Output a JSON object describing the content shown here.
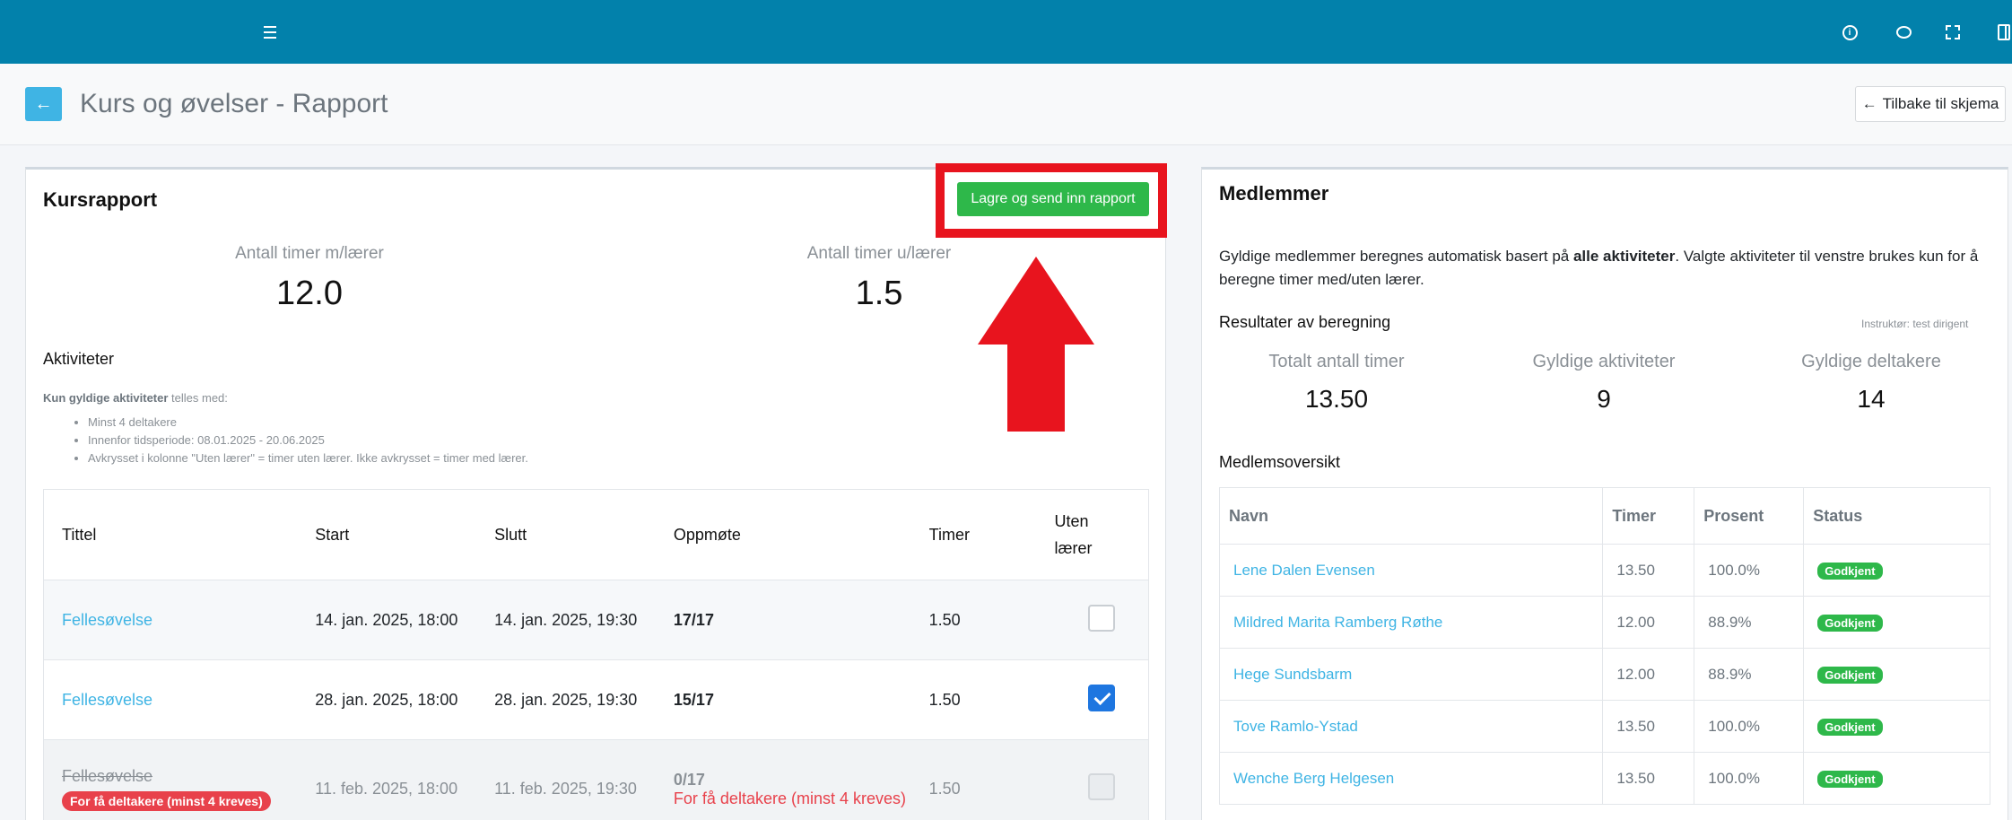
{
  "icons": {
    "menu": "hamburger-icon",
    "info": "info-icon",
    "chat": "chat-icon",
    "fullscreen": "expand-icon",
    "panel": "sidebar-icon",
    "back": "arrow-left-icon"
  },
  "colors": {
    "topbar": "#0281ab",
    "accent": "#3fb4e4",
    "success": "#2eb84a",
    "danger": "#e8414b",
    "annotation": "#e8141e"
  },
  "header": {
    "title": "Kurs og øvelser - Rapport",
    "back_to_form": "Tilbake til skjema"
  },
  "report": {
    "title": "Kursrapport",
    "submit_label": "Lagre og send inn rapport",
    "stat_with_teacher_label": "Antall timer m/lærer",
    "stat_with_teacher_value": "12.0",
    "stat_without_teacher_label": "Antall timer u/lærer",
    "stat_without_teacher_value": "1.5",
    "activities_heading": "Aktiviteter",
    "notes_bold": "Kun gyldige aktiviteter",
    "notes_rest": " telles med:",
    "rules": [
      "Minst 4 deltakere",
      "Innenfor tidsperiode: 08.01.2025 - 20.06.2025",
      "Avkrysset i kolonne \"Uten lærer\" = timer uten lærer. Ikke avkrysset = timer med lærer."
    ],
    "columns": {
      "title": "Tittel",
      "start": "Start",
      "end": "Slutt",
      "attendance": "Oppmøte",
      "hours": "Timer",
      "without_teacher_1": "Uten",
      "without_teacher_2": "lærer"
    },
    "rows": [
      {
        "title": "Fellesøvelse",
        "start": "14. jan. 2025, 18:00",
        "end": "14. jan. 2025, 19:30",
        "attendance": "17/17",
        "hours": "1.50",
        "without_teacher": false
      },
      {
        "title": "Fellesøvelse",
        "start": "28. jan. 2025, 18:00",
        "end": "28. jan. 2025, 19:30",
        "attendance": "15/17",
        "hours": "1.50",
        "without_teacher": true
      },
      {
        "title": "Fellesøvelse",
        "badge": "For få deltakere (minst 4 kreves)",
        "start": "11. feb. 2025, 18:00",
        "end": "11. feb. 2025, 19:30",
        "attendance": "0/17",
        "warning": "For få deltakere (minst 4 kreves)",
        "hours": "1.50",
        "without_teacher": false
      }
    ]
  },
  "members": {
    "title": "Medlemmer",
    "desc_part1": "Gyldige medlemmer beregnes automatisk basert på ",
    "desc_bold": "alle aktiviteter",
    "desc_part2": ". Valgte aktiviteter til venstre brukes kun for å beregne timer med/uten lærer.",
    "results_heading": "Resultater av beregning",
    "instructor": "Instruktør: test dirigent",
    "stats": [
      {
        "label": "Totalt antall timer",
        "value": "13.50"
      },
      {
        "label": "Gyldige aktiviteter",
        "value": "9"
      },
      {
        "label": "Gyldige deltakere",
        "value": "14"
      }
    ],
    "overview_heading": "Medlemsoversikt",
    "columns": {
      "name": "Navn",
      "hours": "Timer",
      "percent": "Prosent",
      "status": "Status"
    },
    "rows": [
      {
        "name": "Lene Dalen Evensen",
        "hours": "13.50",
        "percent": "100.0%",
        "status": "Godkjent"
      },
      {
        "name": "Mildred Marita Ramberg Røthe",
        "hours": "12.00",
        "percent": "88.9%",
        "status": "Godkjent"
      },
      {
        "name": "Hege Sundsbarm",
        "hours": "12.00",
        "percent": "88.9%",
        "status": "Godkjent"
      },
      {
        "name": "Tove Ramlo-Ystad",
        "hours": "13.50",
        "percent": "100.0%",
        "status": "Godkjent"
      },
      {
        "name": "Wenche Berg Helgesen",
        "hours": "13.50",
        "percent": "100.0%",
        "status": "Godkjent"
      }
    ]
  }
}
